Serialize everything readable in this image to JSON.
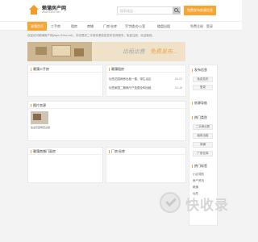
{
  "header": {
    "brand": "赖蒲房产网",
    "brand_sub": "www.51fcs.net",
    "search_placeholder": "搜索楼盘",
    "publish_label": "免费发布房源信息"
  },
  "nav": {
    "items": [
      "赖蒲首页",
      "二手房",
      "租房",
      "商铺",
      "厂房/仓库",
      "写字楼/办公室",
      "楼盘出租"
    ],
    "active_index": 0,
    "right_links": [
      "免费注册",
      "登录"
    ]
  },
  "notice": "欢迎访问赖蒲房产网(laipu.51fcs.net)，本站提供二手房房源信息发布查询服务，免费注册，欢迎使用。",
  "banner": {
    "text1": "出租出售",
    "text2": "免费发布..."
  },
  "panels": {
    "second_hand": {
      "title": "赖蒲二手房"
    },
    "rental": {
      "title": "赖蒲租房",
      "rows": [
        {
          "text": "仙岳花园两房出租一楼，带生活区",
          "date": "05-22"
        },
        {
          "text": "仙岳家园二期两厅户型图全明出租",
          "date": "04-18"
        }
      ]
    },
    "pictures": {
      "title": "图片房源",
      "caption": "仙岳花园两室出租"
    },
    "shops": {
      "title": "赖蒲商铺门面房"
    },
    "factory": {
      "title": "厂房/仓库"
    }
  },
  "sidebar": {
    "section1_title": "发布信息",
    "section1_items": [
      "免费发布",
      "登录"
    ],
    "section2_title": "房源导航",
    "section3_title": "热门类别",
    "section3_items": [
      "二手房出售",
      "租房出租",
      "商铺",
      "厂房仓库"
    ],
    "section4_title": "热门标签",
    "section4_items": [
      "小区导航",
      "房产资讯",
      "赖蒲",
      "仙岳"
    ]
  },
  "watermark": "快收录"
}
